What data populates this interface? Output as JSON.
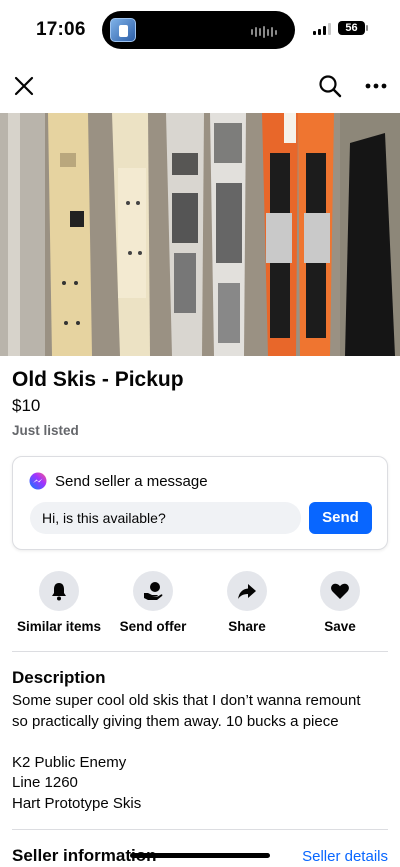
{
  "status_bar": {
    "time": "17:06",
    "battery": "56"
  },
  "nav": {
    "close_icon": "close-icon",
    "search_icon": "search-icon",
    "more_icon": "more-icon"
  },
  "listing": {
    "title": "Old Skis - Pickup",
    "price": "$10",
    "listed": "Just listed"
  },
  "message_card": {
    "header": "Send seller a message",
    "input_value": "Hi, is this available?",
    "send_label": "Send"
  },
  "actions": [
    {
      "label": "Similar items",
      "icon": "bell-icon"
    },
    {
      "label": "Send offer",
      "icon": "offer-icon"
    },
    {
      "label": "Share",
      "icon": "share-icon"
    },
    {
      "label": "Save",
      "icon": "heart-icon"
    }
  ],
  "description": {
    "title": "Description",
    "lines": [
      "Some super cool old skis that I don’t wanna remount",
      "so practically giving them away. 10 bucks a piece",
      "",
      "K2 Public Enemy",
      "Line 1260",
      "Hart Prototype Skis"
    ]
  },
  "seller": {
    "title": "Seller information",
    "details_link": "Seller details"
  },
  "colors": {
    "accent": "#0866ff",
    "action_bg": "#e4e6eb",
    "muted_text": "#65676b"
  }
}
